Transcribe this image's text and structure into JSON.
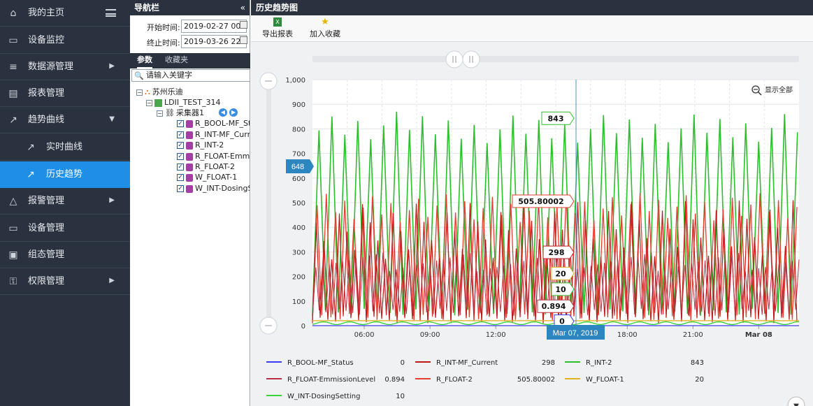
{
  "sidebar": {
    "items": [
      {
        "label": "我的主页",
        "icon": "home-icon",
        "glyph": "⌂"
      },
      {
        "label": "设备监控",
        "icon": "monitor-icon",
        "glyph": "▭"
      },
      {
        "label": "数据源管理",
        "icon": "database-icon",
        "glyph": "≡"
      },
      {
        "label": "报表管理",
        "icon": "document-icon",
        "glyph": "▤"
      },
      {
        "label": "趋势曲线",
        "icon": "trend-line-icon",
        "glyph": "↗"
      },
      {
        "label": "实时曲线",
        "icon": "realtime-chart-icon",
        "glyph": "↗"
      },
      {
        "label": "历史趋势",
        "icon": "history-chart-icon",
        "glyph": "↗"
      },
      {
        "label": "报警管理",
        "icon": "bell-icon",
        "glyph": "△"
      },
      {
        "label": "设备管理",
        "icon": "device-icon",
        "glyph": "▭"
      },
      {
        "label": "组态管理",
        "icon": "config-icon",
        "glyph": "▣"
      },
      {
        "label": "权限管理",
        "icon": "key-icon",
        "glyph": "⚿"
      }
    ]
  },
  "nav": {
    "title": "导航栏",
    "collapse": "«",
    "start_label": "开始时间:",
    "start_value": "2019-02-27 00",
    "end_label": "终止时间:",
    "end_value": "2019-03-26 22",
    "tab_params": "参数",
    "tab_favorites": "收藏夹",
    "search_placeholder": "请输入关键字",
    "tree": {
      "company": "苏州乐迪",
      "device": "LDII_TEST_314",
      "collector": "采集器1",
      "tags": [
        "R_BOOL-MF_Sta",
        "R_INT-MF_Curre",
        "R_INT-2",
        "R_FLOAT-Emmi",
        "R_FLOAT-2",
        "W_FLOAT-1",
        "W_INT-DosingS"
      ]
    }
  },
  "main": {
    "title": "历史趋势图",
    "export_label": "导出报表",
    "favorite_label": "加入收藏",
    "show_all": "显示全部"
  },
  "chart_data": {
    "type": "line",
    "x_ticks": [
      "06:00",
      "09:00",
      "12:00",
      "18:00",
      "21:00",
      "Mar 08"
    ],
    "y_ticks": [
      "0",
      "100",
      "200",
      "300",
      "400",
      "500",
      "600",
      "700",
      "800",
      "900",
      "1,000"
    ],
    "ylim": [
      0,
      1000
    ],
    "grid": true,
    "crosshair": {
      "x_label": "Mar 07, 2019",
      "y_label": "648"
    },
    "tooltip_values": [
      "843",
      "505.80002",
      "298",
      "20",
      "10",
      "0.894",
      "0"
    ],
    "series": [
      {
        "name": "R_BOOL-MF_Status",
        "color": "#3a3af0",
        "value": "0"
      },
      {
        "name": "R_INT-MF_Current",
        "color": "#c01818",
        "value": "298"
      },
      {
        "name": "R_INT-2",
        "color": "#2bbf2b",
        "value": "843"
      },
      {
        "name": "R_FLOAT-EmmissionLevel",
        "color": "#b83040",
        "value": "0.894"
      },
      {
        "name": "R_FLOAT-2",
        "color": "#e63d2e",
        "value": "505.80002"
      },
      {
        "name": "W_FLOAT-1",
        "color": "#e0b020",
        "value": "20"
      },
      {
        "name": "W_INT-DosingSetting",
        "color": "#3ad23a",
        "value": "10"
      }
    ]
  }
}
